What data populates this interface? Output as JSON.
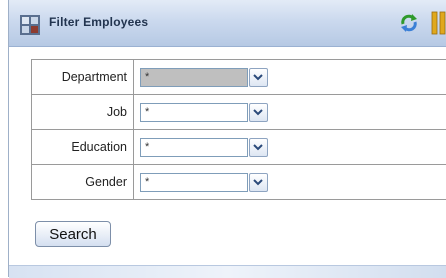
{
  "window": {
    "title": "Filter Employees",
    "icons": {
      "app": "grid-app-icon",
      "refresh": "refresh-icon",
      "pause": "pause-icon"
    }
  },
  "form": {
    "fields": [
      {
        "label": "Department",
        "value": "*",
        "selected": true
      },
      {
        "label": "Job",
        "value": "*",
        "selected": false
      },
      {
        "label": "Education",
        "value": "*",
        "selected": false
      },
      {
        "label": "Gender",
        "value": "*",
        "selected": false
      }
    ],
    "search_label": "Search"
  },
  "colors": {
    "titlebar": "#cbd9ee",
    "border": "#9a9a9a",
    "accent": "#7f9db9"
  }
}
